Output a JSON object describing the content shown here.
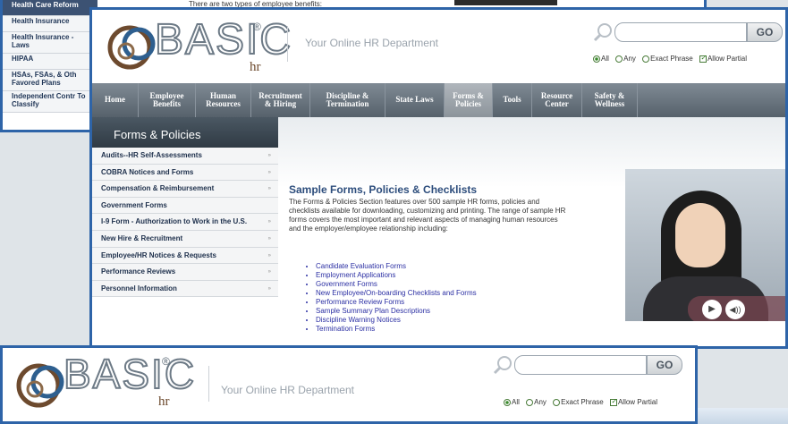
{
  "back_window": {
    "sidebar_items": [
      "Health Care Reform",
      "Health Insurance",
      "Health Insurance - Laws",
      "HIPAA",
      "HSAs, FSAs, & Oth Favored Plans",
      "Independent Contr To Classify"
    ],
    "intro_text": "There are two types of employee benefits:"
  },
  "header": {
    "logo_text": "BASIC",
    "logo_reg": "®",
    "logo_hr": "hr",
    "tagline": "Your Online HR Department",
    "search_placeholder": "",
    "go_label": "GO",
    "opt_all": "All",
    "opt_any": "Any",
    "opt_exact": "Exact Phrase",
    "opt_partial": "Allow Partial"
  },
  "nav": [
    {
      "label": "Home"
    },
    {
      "label": "Employee Benefits"
    },
    {
      "label": "Human Resources"
    },
    {
      "label": "Recruitment & Hiring"
    },
    {
      "label": "Discipline & Termination"
    },
    {
      "label": "State Laws"
    },
    {
      "label": "Forms & Policies"
    },
    {
      "label": "Tools"
    },
    {
      "label": "Resource Center"
    },
    {
      "label": "Safety & Wellness"
    }
  ],
  "sidebar": {
    "title": "Forms & Policies",
    "items": [
      {
        "label": "Audits--HR Self-Assessments"
      },
      {
        "label": "COBRA Notices and Forms"
      },
      {
        "label": "Compensation & Reimbursement"
      },
      {
        "label": "Government Forms"
      },
      {
        "label": "I-9 Form - Authorization to Work in the U.S."
      },
      {
        "label": "New Hire & Recruitment"
      },
      {
        "label": "Employee/HR Notices & Requests"
      },
      {
        "label": "Performance Reviews"
      },
      {
        "label": "Personnel Information"
      }
    ]
  },
  "main": {
    "title": "Sample Forms, Policies & Checklists",
    "body": "The Forms & Policies Section features over 500 sample HR forms, policies and checklists available for downloading, customizing and printing. The range of sample HR forms covers the most important and relevant aspects of managing human resources and the employer/employee relationship including:",
    "list": [
      "Candidate Evaluation Forms",
      "Employment Applications",
      "Government Forms",
      "New Employee/On-boarding Checklists and Forms",
      "Performance Review Forms",
      "Sample Summary Plan Descriptions",
      "Discipline Warning Notices",
      "Termination Forms"
    ]
  }
}
